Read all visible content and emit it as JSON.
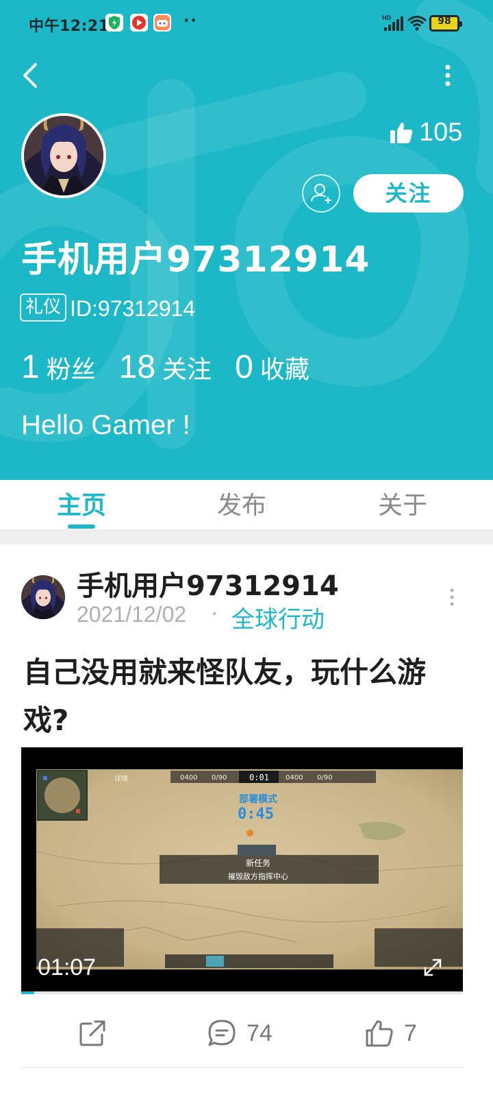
{
  "status_bar": {
    "time": "中午12:21",
    "network_label": "HD",
    "battery": "98",
    "more": "··"
  },
  "header": {
    "likes": "105",
    "follow_label": "关注",
    "name": "手机用户97312914",
    "badge": "礼仪",
    "user_id": "ID:97312914",
    "stats": [
      {
        "num": "1",
        "label": "粉丝"
      },
      {
        "num": "18",
        "label": "关注"
      },
      {
        "num": "0",
        "label": "收藏"
      }
    ],
    "bio": "Hello Gamer !"
  },
  "tabs": [
    {
      "label": "主页",
      "active": true
    },
    {
      "label": "发布",
      "active": false
    },
    {
      "label": "关于",
      "active": false
    }
  ],
  "post": {
    "author": "手机用户97312914",
    "date": "2021/12/02",
    "separator": "·",
    "category": "全球行动",
    "title": "自己没用就来怪队友，玩什么游戏?",
    "video": {
      "duration": "01:07",
      "progress": 0.03,
      "hud": {
        "top_left_resource": "0400",
        "top_left_units": "0/90",
        "clock": "0:01",
        "top_right_resource": "0400",
        "top_right_units": "0/90",
        "details": "详情",
        "mode": "部署模式",
        "countdown": "0:45",
        "mission_title": "新任务",
        "mission_text": "摧毁敌方指挥中心"
      }
    },
    "comments": "74",
    "likes": "7"
  },
  "colors": {
    "brand": "#1cb8c7",
    "battery": "#e8d41c"
  }
}
